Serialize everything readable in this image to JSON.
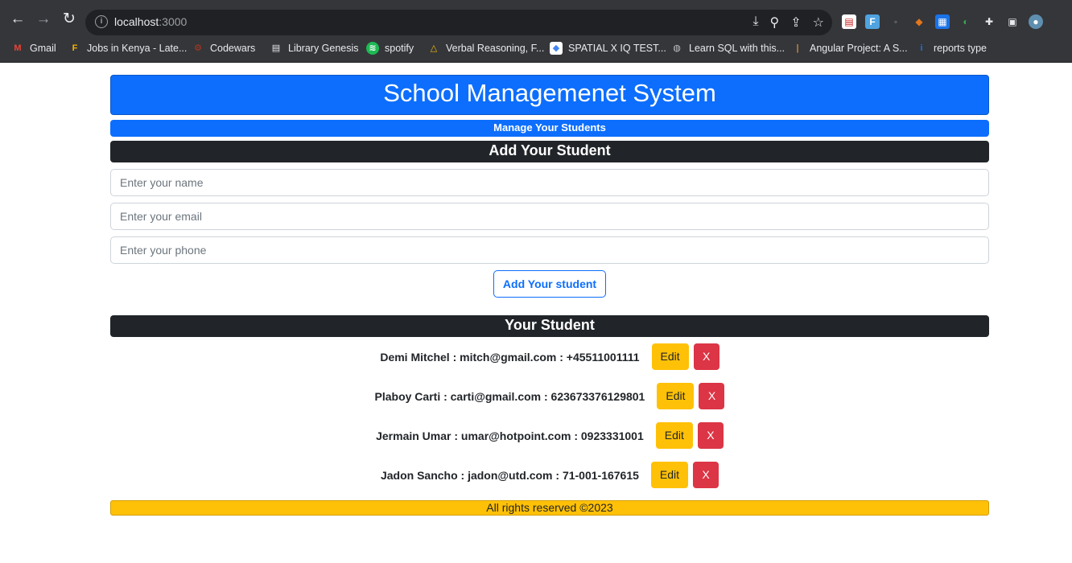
{
  "browser": {
    "url_host": "localhost",
    "url_port": ":3000",
    "bookmarks": [
      {
        "label": "Gmail",
        "icon": "gmail-icon",
        "glyph": "M",
        "color": "#ea4335"
      },
      {
        "label": "Jobs in Kenya - Late...",
        "icon": "jobs-icon",
        "glyph": "F",
        "color": "#f4b400"
      },
      {
        "label": "Codewars",
        "icon": "codewars-icon",
        "glyph": "⚙",
        "color": "#b1361e"
      },
      {
        "label": "Library Genesis",
        "icon": "library-icon",
        "glyph": "▤",
        "color": "#5f6368"
      },
      {
        "label": "spotify",
        "icon": "spotify-icon",
        "glyph": "≋",
        "color": "#1db954"
      },
      {
        "label": "Verbal Reasoning, F...",
        "icon": "drive-icon",
        "glyph": "△",
        "color": "#fbbc04"
      },
      {
        "label": "SPATIAL X IQ TEST...",
        "icon": "photo-icon",
        "glyph": "◆",
        "color": "#4285f4"
      },
      {
        "label": "Learn SQL with this...",
        "icon": "globe-icon",
        "glyph": "◍",
        "color": "#80868b"
      },
      {
        "label": "Angular Project: A S...",
        "icon": "angular-icon",
        "glyph": "|",
        "color": "#c58a3c"
      },
      {
        "label": "reports type",
        "icon": "reports-icon",
        "glyph": "i",
        "color": "#1a73e8"
      }
    ]
  },
  "header": {
    "title": "School Managemenet System",
    "subtitle": "Manage Your Students",
    "form_heading": "Add Your Student"
  },
  "form": {
    "name_placeholder": "Enter your name",
    "email_placeholder": "Enter your email",
    "phone_placeholder": "Enter your phone",
    "submit_label": "Add Your student"
  },
  "students": {
    "heading": "Your Student",
    "edit_label": "Edit",
    "delete_label": "X",
    "items": [
      {
        "text": "Demi Mitchel : mitch@gmail.com : +45511001111"
      },
      {
        "text": "Plaboy Carti : carti@gmail.com : 623673376129801"
      },
      {
        "text": "Jermain Umar : umar@hotpoint.com : 0923331001"
      },
      {
        "text": "Jadon Sancho : jadon@utd.com : 71-001-167615"
      }
    ]
  },
  "footer": {
    "text": "All rights reserved ©2023"
  }
}
